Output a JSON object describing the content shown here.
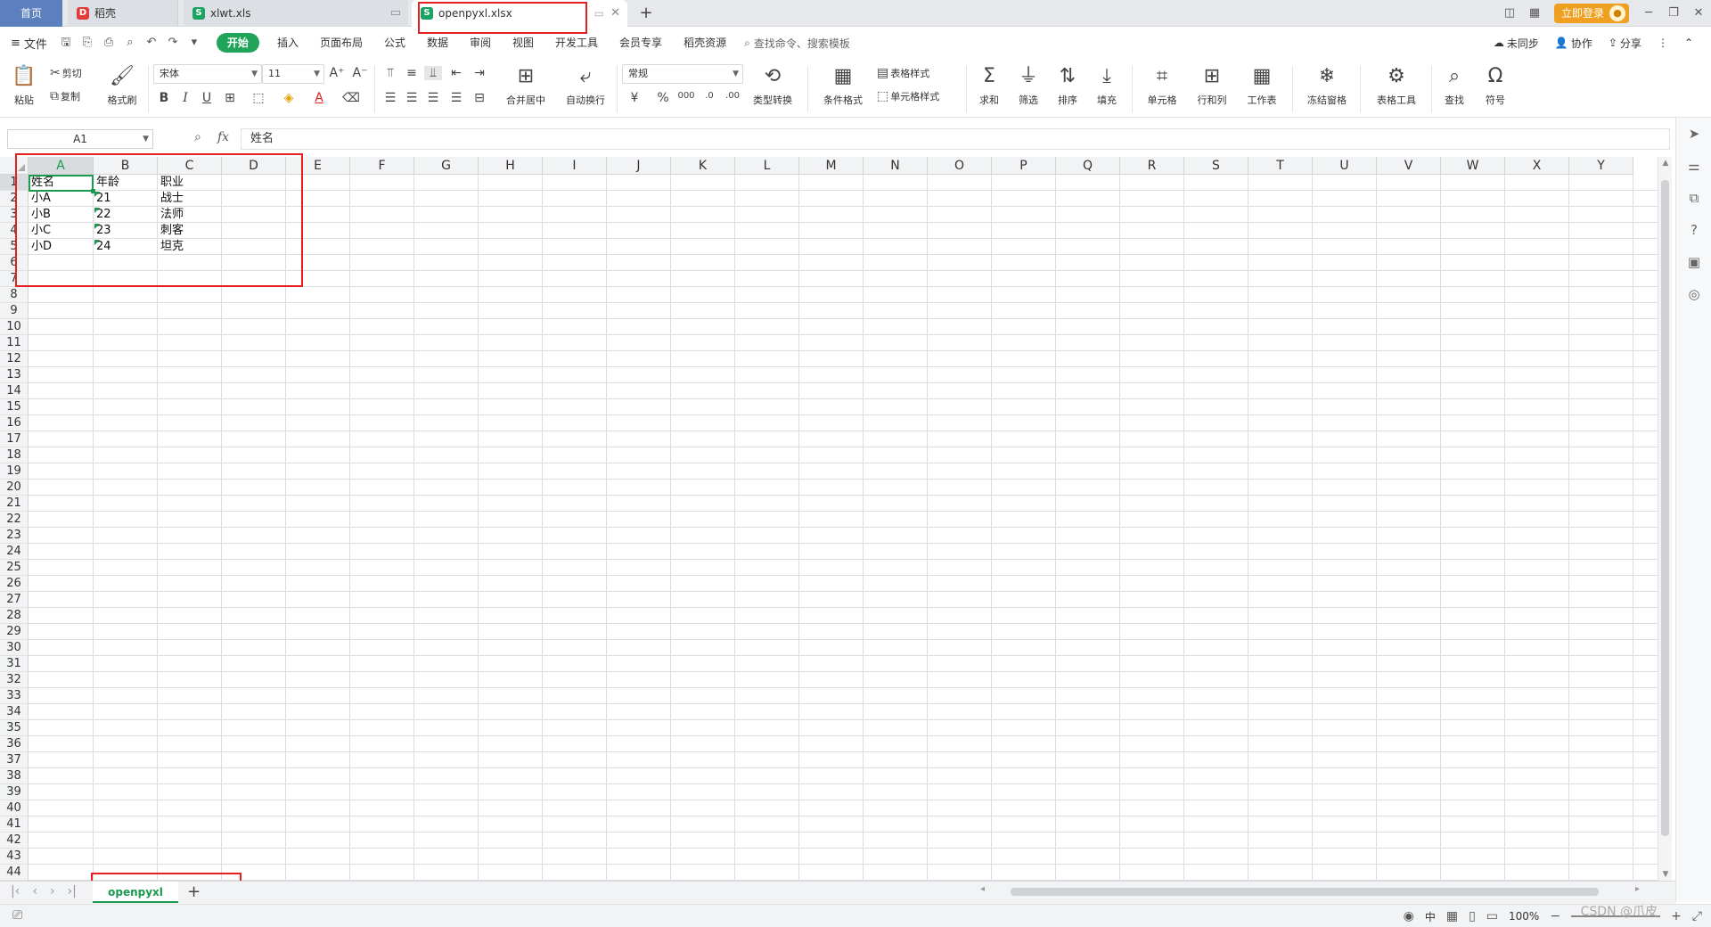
{
  "titlebar": {
    "home_tab": "首页",
    "tabs": [
      {
        "label": "稻壳",
        "icon": "docer-icon"
      },
      {
        "label": "xlwt.xls",
        "icon": "spreadsheet-icon"
      },
      {
        "label": "openpyxl.xlsx",
        "icon": "spreadsheet-icon",
        "active": true
      }
    ],
    "new_tab": "+",
    "login_label": "立即登录"
  },
  "menubar": {
    "file": "文件",
    "tabs": [
      "开始",
      "插入",
      "页面布局",
      "公式",
      "数据",
      "审阅",
      "视图",
      "开发工具",
      "会员专享",
      "稻壳资源"
    ],
    "active_tab": "开始",
    "search_placeholder": "查找命令、搜索模板",
    "right": {
      "sync": "未同步",
      "collab": "协作",
      "share": "分享"
    }
  },
  "ribbon": {
    "paste": "粘贴",
    "cut": "剪切",
    "copy": "复制",
    "format_painter": "格式刷",
    "font_name": "宋体",
    "font_size": "11",
    "merge_center": "合并居中",
    "wrap_text": "自动换行",
    "number_format": "常规",
    "type_convert": "类型转换",
    "cond_format": "条件格式",
    "table_style": "表格样式",
    "cell_style": "单元格样式",
    "sum": "求和",
    "filter": "筛选",
    "sort": "排序",
    "fill": "填充",
    "cell": "单元格",
    "row_col": "行和列",
    "worksheet": "工作表",
    "freeze": "冻结窗格",
    "table_tools": "表格工具",
    "find": "查找",
    "symbol": "符号"
  },
  "formula_bar": {
    "name_box": "A1",
    "fx": "fx",
    "value": "姓名"
  },
  "columns": [
    "A",
    "B",
    "C",
    "D",
    "E",
    "F",
    "G",
    "H",
    "I",
    "J",
    "K",
    "L",
    "M",
    "N",
    "O",
    "P",
    "Q",
    "R",
    "S",
    "T",
    "U",
    "V",
    "W",
    "X",
    "Y"
  ],
  "rows": [
    "1",
    "2",
    "3",
    "4",
    "5",
    "6",
    "7",
    "8",
    "9",
    "10",
    "11",
    "12",
    "13",
    "14",
    "15",
    "16",
    "17",
    "18",
    "19",
    "20",
    "21",
    "22",
    "23",
    "24",
    "25",
    "26",
    "27",
    "28",
    "29",
    "30",
    "31",
    "32",
    "33",
    "34",
    "35",
    "36",
    "37",
    "38",
    "39",
    "40",
    "41",
    "42",
    "43",
    "44"
  ],
  "sheet_cells": {
    "headers": [
      "姓名",
      "年龄",
      "职业"
    ],
    "data": [
      [
        "小A",
        "21",
        "战士"
      ],
      [
        "小B",
        "22",
        "法师"
      ],
      [
        "小C",
        "23",
        "刺客"
      ],
      [
        "小D",
        "24",
        "坦克"
      ]
    ]
  },
  "sheetbar": {
    "sheet_name": "openpyxl",
    "add": "+"
  },
  "statusbar": {
    "ime": "中",
    "zoom": "100%"
  },
  "watermark": "CSDN @爪皮",
  "colors": {
    "accent": "#1a9a50",
    "highlight_box": "#e62020",
    "home_tab": "#5b7fbf",
    "login": "#f0a020"
  }
}
